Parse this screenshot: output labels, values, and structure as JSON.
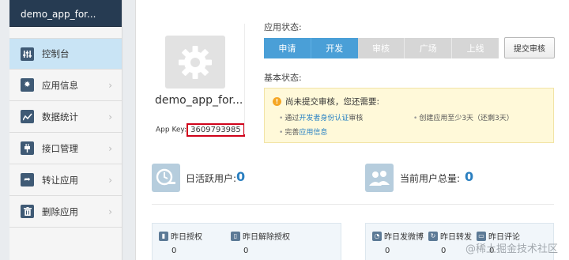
{
  "sidebar": {
    "app_title": "demo_app_for...",
    "items": [
      {
        "label": "控制台"
      },
      {
        "label": "应用信息"
      },
      {
        "label": "数据统计"
      },
      {
        "label": "接口管理"
      },
      {
        "label": "转让应用"
      },
      {
        "label": "删除应用"
      }
    ]
  },
  "app": {
    "name": "demo_app_for...",
    "key_label": "App Key:",
    "key_value": "3609793985"
  },
  "status": {
    "label": "应用状态:",
    "steps": [
      {
        "label": "申请",
        "state": "done"
      },
      {
        "label": "开发",
        "state": "done"
      },
      {
        "label": "审核",
        "state": "pending"
      },
      {
        "label": "广场",
        "state": "pending"
      },
      {
        "label": "上线",
        "state": "pending"
      }
    ],
    "submit_label": "提交审核"
  },
  "basic": {
    "label": "基本状态:",
    "notice_title": "尚未提交审核，您还需要:",
    "todo1_prefix": "通过",
    "todo1_link": "开发者身份认证",
    "todo1_suffix": "审核",
    "todo2_prefix": "完善",
    "todo2_link": "应用信息",
    "todo3": "创建应用至少3天（还剩3天）"
  },
  "stats": {
    "dau_label": "日活跃用户:",
    "dau_value": "0",
    "total_label": "当前用户总量:",
    "total_value": "0"
  },
  "panels": {
    "auth_label": "昨日授权",
    "auth_value": "0",
    "unauth_label": "昨日解除授权",
    "unauth_value": "0",
    "post_label": "昨日发微博",
    "post_value": "0",
    "repost_label": "昨日转发",
    "repost_value": "0",
    "comment_label": "昨日评论",
    "comment_value": "0"
  },
  "watermark": "@稀土掘金技术社区",
  "colors": {
    "sidebar_header": "#263b52",
    "sidebar_active": "#c9e4f5",
    "step_done": "#4a9fd7",
    "step_pending": "#d6d6d6",
    "value_blue": "#2a7fc0",
    "highlight_red": "#d0021b",
    "notice_bg": "#fff9d9"
  }
}
